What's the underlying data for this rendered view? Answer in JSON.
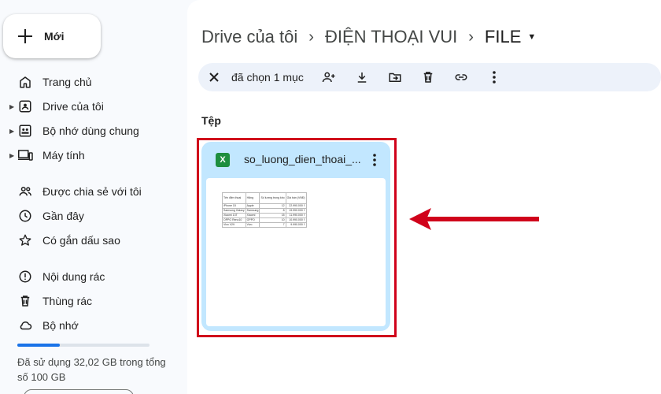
{
  "sidebar": {
    "new_label": "Mới",
    "items": [
      {
        "label": "Trang chủ"
      },
      {
        "label": "Drive của tôi"
      },
      {
        "label": "Bộ nhớ dùng chung"
      },
      {
        "label": "Máy tính"
      },
      {
        "label": "Được chia sẻ với tôi"
      },
      {
        "label": "Gần đây"
      },
      {
        "label": "Có gắn dấu sao"
      },
      {
        "label": "Nội dung rác"
      },
      {
        "label": "Thùng rác"
      },
      {
        "label": "Bộ nhớ"
      }
    ],
    "storage_used_fraction": 0.32,
    "storage_text": "Đã sử dụng 32,02 GB trong tổng số 100 GB"
  },
  "breadcrumb": {
    "root": "Drive của tôi",
    "folder": "ĐIỆN THOẠI VUI",
    "current": "FILE"
  },
  "selection_bar": {
    "count_text": "đã chọn 1 mục",
    "actions": [
      "close-icon",
      "share-person-icon",
      "download-icon",
      "move-icon",
      "delete-icon",
      "link-icon",
      "more-vert-icon"
    ]
  },
  "files_section": {
    "title": "Tệp",
    "file": {
      "name": "so_luong_dien_thoai_...",
      "type_icon_letter": "X",
      "type_icon_color": "#1e8e3e",
      "card_color": "#c2e7ff"
    }
  },
  "thumbnail_table": {
    "headers": [
      "Tên điện thoại",
      "Hãng",
      "Số lượng trong kho",
      "Giá bán (VNĐ)"
    ],
    "rows": [
      [
        "iPhone 15",
        "Apple",
        "12",
        "22.990.000 ₫"
      ],
      [
        "Samsung Galaxy",
        "Samsung",
        "8",
        "19.990.000 ₫"
      ],
      [
        "Xiaomi 13T",
        "Xiaomi",
        "15",
        "11.990.000 ₫"
      ],
      [
        "OPPO Reno10",
        "OPPO",
        "10",
        "10.990.000 ₫"
      ],
      [
        "Vivo V29",
        "Vivo",
        "7",
        "9.990.000 ₫"
      ]
    ]
  },
  "colors": {
    "accent": "#1a73e8",
    "highlight": "#d0021b",
    "selection_bar_bg": "#edf2fa"
  }
}
